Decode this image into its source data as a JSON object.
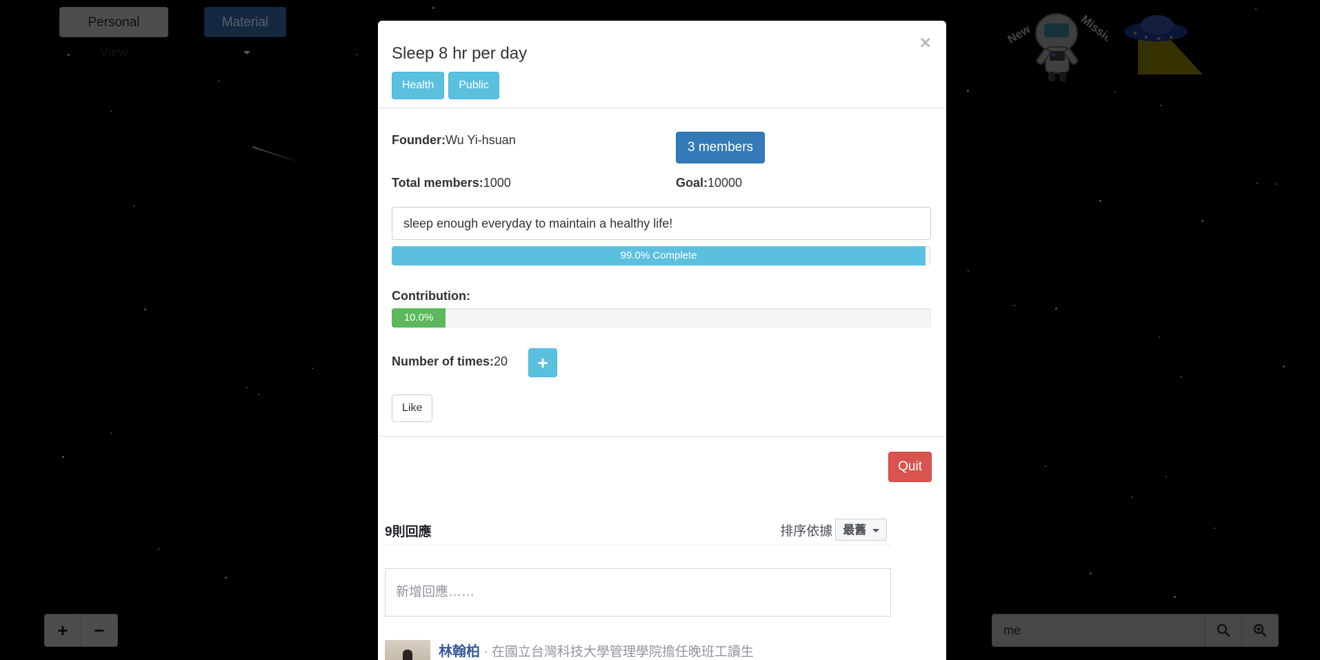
{
  "top_bar": {
    "personal_view_label": "Personal View",
    "material_label": "Material"
  },
  "astronaut": {
    "banner_left": "New",
    "banner_right": "Mission"
  },
  "modal": {
    "title": "Sleep 8 hr per day",
    "close_label": "×",
    "tags": [
      "Health",
      "Public"
    ],
    "founder_label": "Founder:",
    "founder_value": "Wu Yi-hsuan",
    "members_button": "3 members",
    "total_members_label": "Total members:",
    "total_members_value": "1000",
    "goal_label": "Goal:",
    "goal_value": "10000",
    "description": "sleep enough everyday to maintain a healthy life!",
    "progress": {
      "percent": 99.0,
      "text": "99.0% Complete"
    },
    "contribution_label": "Contribution:",
    "contribution": {
      "percent": 10.0,
      "text": "10.0%"
    },
    "times_label": "Number of times:",
    "times_value": "20",
    "plus_label": "+",
    "like_label": "Like",
    "quit_label": "Quit"
  },
  "comments": {
    "count_label": "9則回應",
    "sort_label": "排序依據",
    "sort_value": "最舊",
    "input_placeholder": "新增回應……",
    "first_comment": {
      "author": "林翰柏",
      "separator": " · ",
      "meta": "在國立台灣科技大學管理學院擔任晚班工讀生"
    }
  },
  "zoom_controls": {
    "zoom_in": "+",
    "zoom_out": "−"
  },
  "search": {
    "value": "me"
  },
  "colors": {
    "info": "#5bc0de",
    "primary": "#337ab7",
    "success": "#5cb85c",
    "danger": "#d9534f"
  }
}
